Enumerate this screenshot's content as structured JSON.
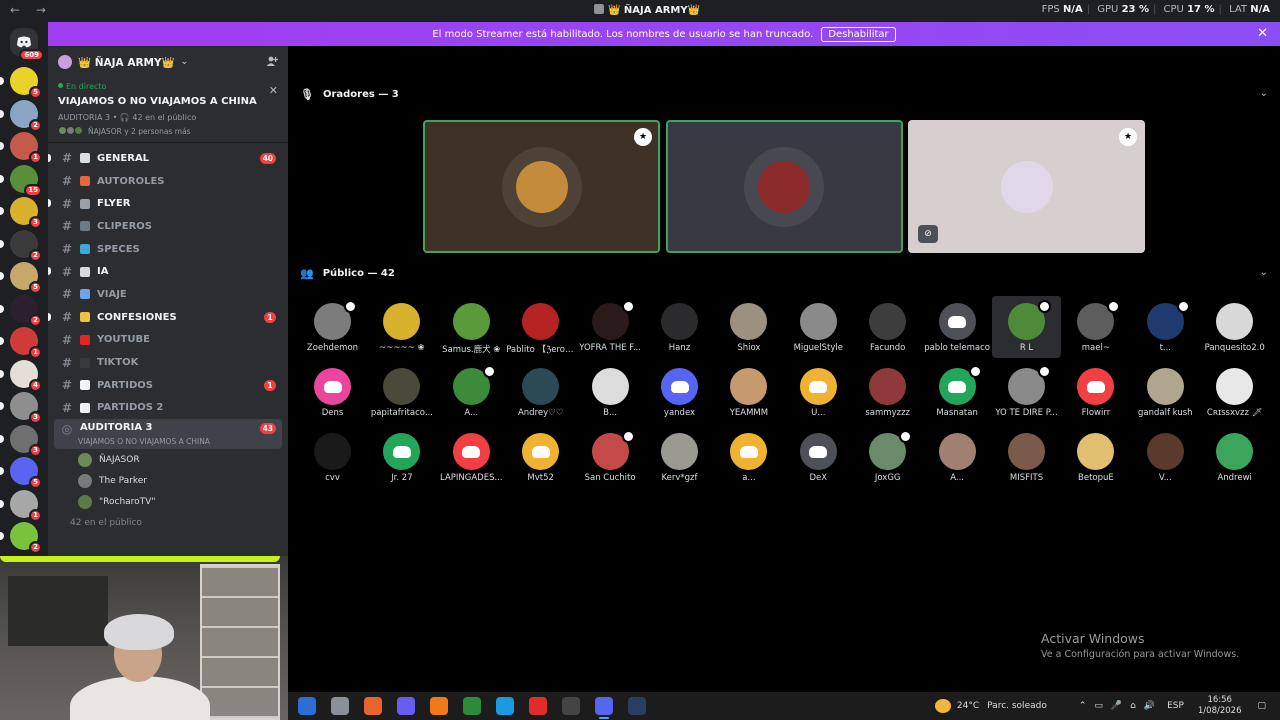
{
  "titlebar": {
    "nav_back": "←",
    "nav_forward": "→",
    "title": "👑 ÑAJA ARMY👑",
    "fps_label": "FPS",
    "fps_value": "N/A",
    "gpu_label": "GPU",
    "gpu_value": "23 %",
    "cpu_label": "CPU",
    "cpu_value": "17 %",
    "lat_label": "LAT",
    "lat_value": "N/A"
  },
  "banner": {
    "text": "El modo Streamer está habilitado. Los nombres de usuario se han truncado.",
    "button": "Deshabilitar",
    "close": "✕"
  },
  "rail": {
    "home_badge": "609",
    "servers": [
      {
        "color": "#e9d32a",
        "badge": "5"
      },
      {
        "color": "#8aa6c4",
        "badge": "2"
      },
      {
        "color": "#c45a4a",
        "badge": "1"
      },
      {
        "color": "#5a8f3a",
        "badge": "15"
      },
      {
        "color": "#d8b12d",
        "badge": "3"
      },
      {
        "color": "#3b3b3b",
        "badge": "2"
      },
      {
        "color": "#c7a76a",
        "badge": "5"
      },
      {
        "color": "#2a2030",
        "badge": "2"
      },
      {
        "color": "#cf3b3b",
        "badge": "1"
      },
      {
        "color": "#e3ded6",
        "badge": "4"
      },
      {
        "color": "#8e8e8e",
        "badge": "3"
      },
      {
        "color": "#6f6f6f",
        "badge": "3"
      },
      {
        "color": "#5865f2",
        "badge": "5"
      },
      {
        "color": "#a7a7a7",
        "badge": "1"
      },
      {
        "color": "#79c33c",
        "badge": "2"
      }
    ]
  },
  "sidebar": {
    "guild_name": "👑 ÑAJA ARMY👑",
    "guild_chevron": "⌄",
    "live_label": "En directo",
    "live_title": "VIAJAMOS O NO VIAJAMOS A CHINA",
    "live_meta": "AUDITORIA 3  •  🎧 42 en el público",
    "live_people": "ÑAJASOR y 2 personas más",
    "close": "✕",
    "channels": [
      {
        "label": "GENERAL",
        "emoji_color": "#dbdee1",
        "unread": true,
        "count": "40"
      },
      {
        "label": "AUTOROLES",
        "emoji_color": "#e3673a",
        "unread": false,
        "count": ""
      },
      {
        "label": "FLYER",
        "emoji_color": "#9aa0a6",
        "unread": true,
        "count": ""
      },
      {
        "label": "CLIPEROS",
        "emoji_color": "#6e7a87",
        "unread": false,
        "count": ""
      },
      {
        "label": "SPECES",
        "emoji_color": "#3aa9d8",
        "unread": false,
        "count": ""
      },
      {
        "label": "IA",
        "emoji_color": "#d9dadc",
        "unread": true,
        "count": ""
      },
      {
        "label": "VIAJE",
        "emoji_color": "#6ea5e8",
        "unread": false,
        "count": ""
      },
      {
        "label": "CONFESIONES",
        "emoji_color": "#f0c33c",
        "unread": true,
        "count": "1"
      },
      {
        "label": "YOUTUBE",
        "emoji_color": "#e32424",
        "unread": false,
        "count": ""
      },
      {
        "label": "TIKTOK",
        "emoji_color": "#3a3a3a",
        "unread": false,
        "count": ""
      },
      {
        "label": "PARTIDOS",
        "emoji_color": "#f2f3f5",
        "unread": false,
        "count": "1"
      },
      {
        "label": "PARTIDOS 2",
        "emoji_color": "#f2f3f5",
        "unread": false,
        "count": ""
      }
    ],
    "active_channel": {
      "label": "AUDITORIA 3",
      "count": "43",
      "subtitle": "VIAJAMOS O NO VIAJAMOS A CHINA"
    },
    "members": [
      {
        "name": "ÑAJASOR",
        "color": "#6d8b5a"
      },
      {
        "name": "The Parker",
        "color": "#7a7a7a"
      },
      {
        "name": "\"RocharoTV\"",
        "color": "#5a7a4a"
      }
    ],
    "audience_count": "42 en el público"
  },
  "main": {
    "speakers_header": "Oradores — 3",
    "audience_header": "Público — 42",
    "speakers": [
      {
        "bg": "#3f3126",
        "border": "#3ba55c",
        "avatar": "#c48b3a",
        "mod": true,
        "video": false,
        "ring": true
      },
      {
        "bg": "#393943",
        "border": "#3ba55c",
        "avatar": "#8b2b2b",
        "mod": false,
        "video": false,
        "ring": true
      },
      {
        "bg": "#d7cfcf",
        "border": "#d7cfcf",
        "avatar": "#e0d8e8",
        "mod": true,
        "video": true,
        "ring": false
      }
    ],
    "audience": [
      {
        "name": "Zoehdemon",
        "color": "#7c7c7c",
        "discord": false,
        "mic": true
      },
      {
        "name": "~~~~~ ❀",
        "color": "#d8b12d",
        "discord": false,
        "mic": false
      },
      {
        "name": "Samus.鹿犬 ❀",
        "color": "#5a9a3a",
        "discord": false,
        "mic": false
      },
      {
        "name": "Pablito 【ℨero ...",
        "color": "#b42222",
        "discord": false,
        "mic": false
      },
      {
        "name": "YOFRA THE F...",
        "color": "#2a1a1a",
        "discord": false,
        "mic": true
      },
      {
        "name": "Hanz",
        "color": "#2b2b2d",
        "discord": false,
        "mic": false
      },
      {
        "name": "Shiox",
        "color": "#9c9080",
        "discord": false,
        "mic": false
      },
      {
        "name": "MiguelStyle",
        "color": "#8a8a8a",
        "discord": false,
        "mic": false
      },
      {
        "name": "Facundo",
        "color": "#3d3d3d",
        "discord": false,
        "mic": false
      },
      {
        "name": "pablo telemaco",
        "color": "#4e5058",
        "discord": true,
        "mic": false
      },
      {
        "name": "R L",
        "color": "#4f8a3a",
        "discord": false,
        "mic": true,
        "highlight": true
      },
      {
        "name": "mael~",
        "color": "#5d5d5d",
        "discord": false,
        "mic": true
      },
      {
        "name": "t...",
        "color": "#1e3a6e",
        "discord": false,
        "mic": true
      },
      {
        "name": "Panquesito2.0",
        "color": "#d8d8d8",
        "discord": false,
        "mic": false
      },
      {
        "name": "Dens",
        "color": "#eb459e",
        "discord": true,
        "mic": false
      },
      {
        "name": "papitafritaco...",
        "color": "#4a4a3a",
        "discord": false,
        "mic": false
      },
      {
        "name": "A...",
        "color": "#3b8b3b",
        "discord": false,
        "mic": true
      },
      {
        "name": "Andrey♡♡",
        "color": "#2a4a55",
        "discord": false,
        "mic": false
      },
      {
        "name": "B...",
        "color": "#dcdcdc",
        "discord": false,
        "mic": false
      },
      {
        "name": "yandex",
        "color": "#5865f2",
        "discord": true,
        "mic": false
      },
      {
        "name": "YEAMMM",
        "color": "#c49a6e",
        "discord": false,
        "mic": false
      },
      {
        "name": "U...",
        "color": "#f0b232",
        "discord": true,
        "mic": false
      },
      {
        "name": "sammyzzz",
        "color": "#8e3a3a",
        "discord": false,
        "mic": false
      },
      {
        "name": "Masnatan",
        "color": "#23a55a",
        "discord": true,
        "mic": true
      },
      {
        "name": "YO TE DIRE P...",
        "color": "#8a8a8a",
        "discord": false,
        "mic": true
      },
      {
        "name": "Flowirr",
        "color": "#f23f43",
        "discord": true,
        "mic": false
      },
      {
        "name": "gandalf kush",
        "color": "#b0a58f",
        "discord": false,
        "mic": false
      },
      {
        "name": "Cʀɪssxvzz 🗡",
        "color": "#e8e8e8",
        "discord": false,
        "mic": false
      },
      {
        "name": "cvv",
        "color": "#1a1a1a",
        "discord": false,
        "mic": false
      },
      {
        "name": "Jr. 27",
        "color": "#23a55a",
        "discord": true,
        "mic": false
      },
      {
        "name": "LAPINGADES...",
        "color": "#f23f43",
        "discord": true,
        "mic": false
      },
      {
        "name": "Mvt52",
        "color": "#f0b232",
        "discord": true,
        "mic": false
      },
      {
        "name": "San Cuchito",
        "color": "#c44a4a",
        "discord": false,
        "mic": true
      },
      {
        "name": "Kerv*gzf",
        "color": "#9a9a90",
        "discord": false,
        "mic": false
      },
      {
        "name": "a...",
        "color": "#f0b232",
        "discord": true,
        "mic": false
      },
      {
        "name": "DeX",
        "color": "#4e5058",
        "discord": true,
        "mic": false
      },
      {
        "name": "JoxGG",
        "color": "#6a8a6a",
        "discord": false,
        "mic": true
      },
      {
        "name": "A...",
        "color": "#a08070",
        "discord": false,
        "mic": false
      },
      {
        "name": "MISFITS",
        "color": "#7a5a4a",
        "discord": false,
        "mic": false
      },
      {
        "name": "BetopuE",
        "color": "#e0c070",
        "discord": false,
        "mic": false
      },
      {
        "name": "V...",
        "color": "#5a3a2a",
        "discord": false,
        "mic": false
      },
      {
        "name": "Andrewi",
        "color": "#3ba55c",
        "discord": false,
        "mic": false
      }
    ]
  },
  "activate_windows": {
    "title": "Activar Windows",
    "subtitle": "Ve a Configuración para activar Windows."
  },
  "taskbar": {
    "apps": [
      "#2b6fd6",
      "#8a8f98",
      "#e8642c",
      "#6b5cf0",
      "#f07a1a",
      "#2a8a3a",
      "#1a9ae0",
      "#e22b2b",
      "#444",
      "#5865f2",
      "#2a3f5f"
    ],
    "temperature": "24°C",
    "weather": "Parc. soleado",
    "lang": "ESP",
    "time": "16:56",
    "date": "1/08/2026"
  }
}
